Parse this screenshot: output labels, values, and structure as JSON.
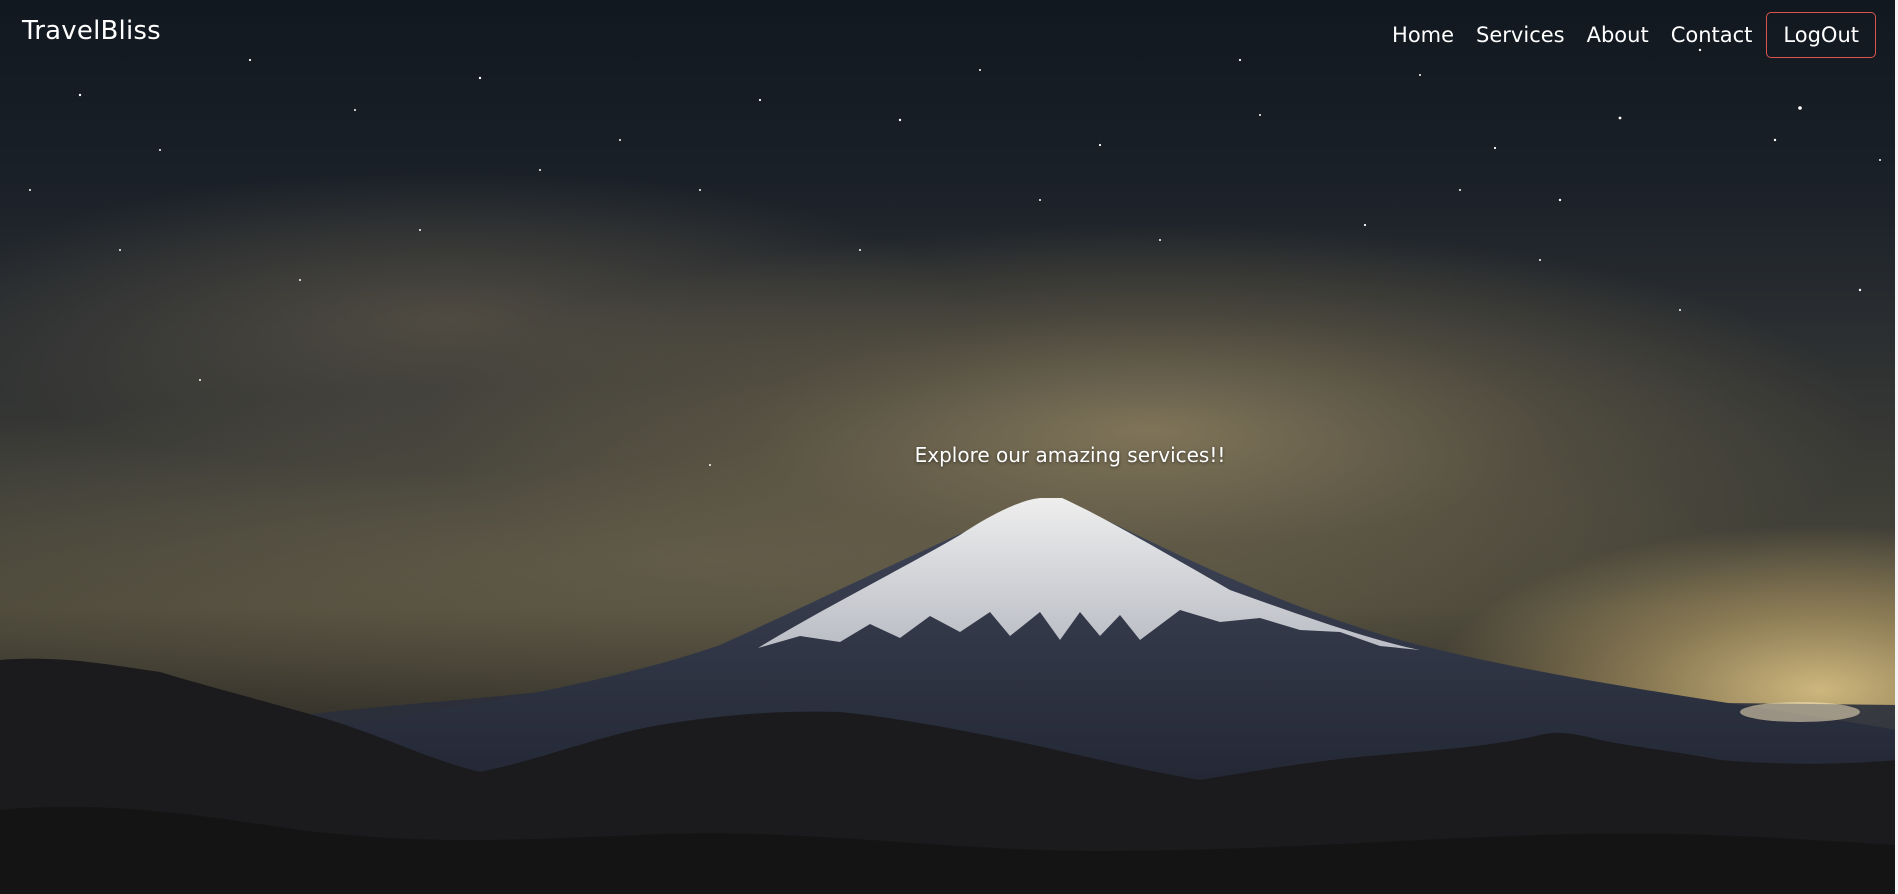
{
  "navbar": {
    "brand": "TravelBliss",
    "links": [
      "Home",
      "Services",
      "About",
      "Contact"
    ],
    "logout_label": "LogOut"
  },
  "hero": {
    "tagline": "Explore our amazing services!!"
  },
  "colors": {
    "logout_border": "#d9534f",
    "text": "#ffffff"
  }
}
